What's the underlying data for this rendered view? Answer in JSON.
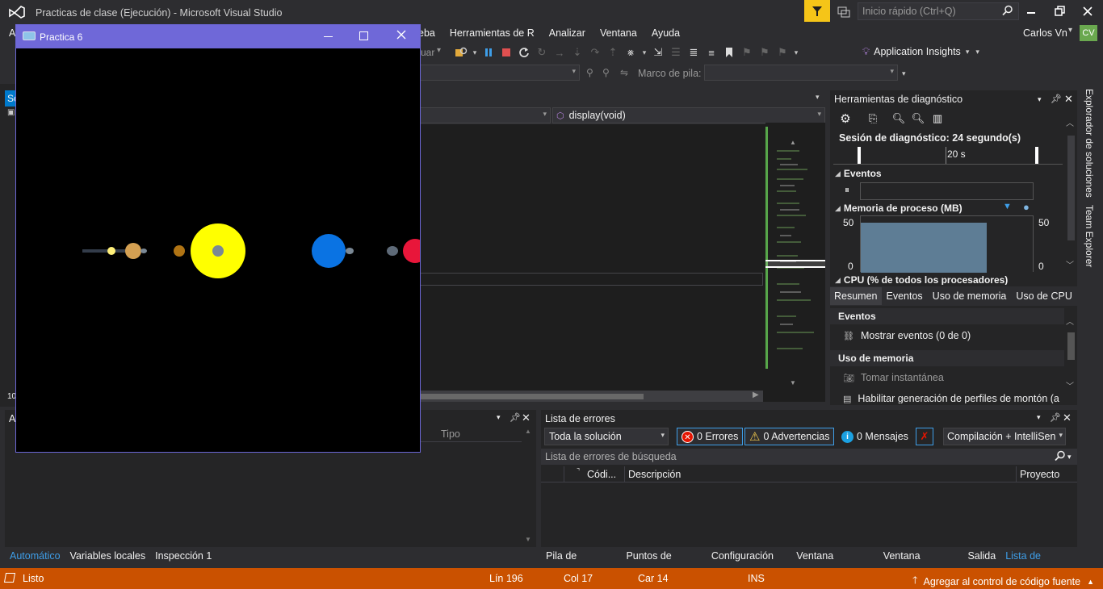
{
  "titlebar": {
    "title": "Practicas de clase (Ejecución) - Microsoft Visual Studio",
    "quick_launch_placeholder": "Inicio rápido (Ctrl+Q)"
  },
  "menubar": {
    "partial_first": "A",
    "items": [
      "eba",
      "Herramientas de R",
      "Analizar",
      "Ventana",
      "Ayuda"
    ],
    "user": "Carlos Vn",
    "user_initials": "CV"
  },
  "toolbar": {
    "partial_continue": "uar",
    "app_insights": "Application Insights",
    "stack_frame_label": "Marco de pila:"
  },
  "editor": {
    "function_dropdown": "display(void)"
  },
  "diagnostics": {
    "title": "Herramientas de diagnóstico",
    "session": "Sesión de diagnóstico: 24 segundo(s)",
    "time_label": "20 s",
    "events_header": "Eventos",
    "memory_header": "Memoria de proceso (MB)",
    "mem_max_left": "50",
    "mem_min_left": "0",
    "mem_max_right": "50",
    "mem_min_right": "0",
    "cpu_header": "CPU (% de todos los procesadores)",
    "tabs": [
      "Resumen",
      "Eventos",
      "Uso de memoria",
      "Uso de CPU"
    ],
    "summary_events_h": "Eventos",
    "show_events": "Mostrar eventos (0 de 0)",
    "memory_usage_h": "Uso de memoria",
    "take_snapshot": "Tomar instantánea",
    "enable_profiling": "Habilitar generación de perfiles de montón (a"
  },
  "sidetabs": {
    "solution_explorer": "Explorador de soluciones",
    "team_explorer": "Team Explorer"
  },
  "left_partial": {
    "tab": "So",
    "number": "10",
    "panel": "A"
  },
  "autos": {
    "column_type": "Tipo",
    "tabs": [
      "Automático",
      "Variables locales",
      "Inspección 1"
    ]
  },
  "errors": {
    "title": "Lista de errores",
    "scope": "Toda la solución",
    "errors_btn": "0 Errores",
    "warnings_btn": "0 Advertencias",
    "messages_btn": "0 Mensajes",
    "build_filter": "Compilación + IntelliSen",
    "search_placeholder": "Lista de errores de búsqueda",
    "col_code": "Códi...",
    "col_description": "Descripción",
    "col_project": "Proyecto",
    "bottom_tabs": [
      "Pila de llamadas",
      "Puntos de interr...",
      "Configuración d...",
      "Ventana Coman...",
      "Ventana Inmedi...",
      "Salida",
      "Lista de errores"
    ]
  },
  "statusbar": {
    "status": "Listo",
    "line": "Lín 196",
    "col": "Col 17",
    "car": "Car 14",
    "ins": "INS",
    "source_control": "Agregar al control de código fuente"
  },
  "app_window": {
    "title": "Practica 6"
  },
  "colors": {
    "vs_bg": "#2d2d30",
    "accent_blue": "#007acc",
    "status_orange": "#ca5100",
    "app_titlebar": "#6f68d8",
    "sun": "#ffff00",
    "earth": "#0a73e3",
    "mars": "#e8163a"
  }
}
